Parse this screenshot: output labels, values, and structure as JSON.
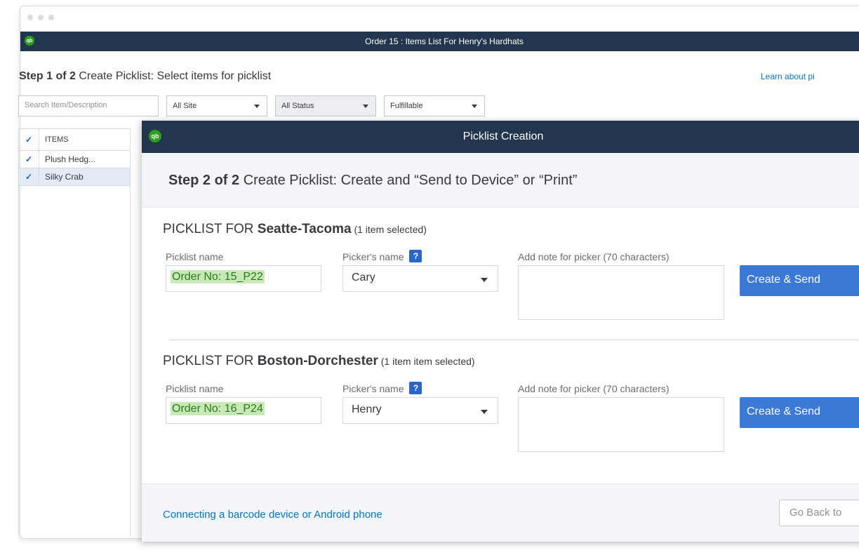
{
  "outer": {
    "title": "Order 15 : Items List For Henry's Hardhats",
    "logo": "qb",
    "step_bold": "Step 1 of 2",
    "step_text": " Create Picklist: Select items for picklist",
    "learn_link": "Learn about pi",
    "search_placeholder": "Search Item/Description",
    "filter_site": "All Site",
    "filter_status": "All Status",
    "filter_fulfill": "Fulfillable",
    "grid_header_check": "✓",
    "grid_header": "ITEMS",
    "rows": [
      {
        "check": "✓",
        "name": "Plush Hedg..."
      },
      {
        "check": "✓",
        "name": "Silky Crab"
      }
    ]
  },
  "modal": {
    "logo": "qb",
    "title": "Picklist Creation",
    "step_bold": "Step 2 of 2",
    "step_text": " Create Picklist: Create and “Send to Device” or “Print”",
    "sections": [
      {
        "prefix": "PICKLIST FOR ",
        "location": "Seatte-Tacoma",
        "count_text": " (1 item selected)",
        "name_label": "Picklist name",
        "name_value": "Order No: 15_P22",
        "picker_label": "Picker's name",
        "help": "?",
        "picker_value": "Cary",
        "note_label": "Add note for picker (70 characters)",
        "button": "Create & Send"
      },
      {
        "prefix": "PICKLIST FOR ",
        "location": "Boston-Dorchester",
        "count_text": " (1 item item selected)",
        "name_label": "Picklist name",
        "name_value": "Order No: 16_P24",
        "picker_label": "Picker's name",
        "help": "?",
        "picker_value": "Henry",
        "note_label": "Add note for picker (70 characters)",
        "button": "Create & Send"
      }
    ],
    "footer_link": "Connecting a barcode device or Android phone",
    "go_back": "Go Back to"
  },
  "colors": {
    "title_bar": "#22364e",
    "brand_green": "#2ca01c",
    "primary_button": "#3a79d6",
    "link": "#0077c5"
  }
}
